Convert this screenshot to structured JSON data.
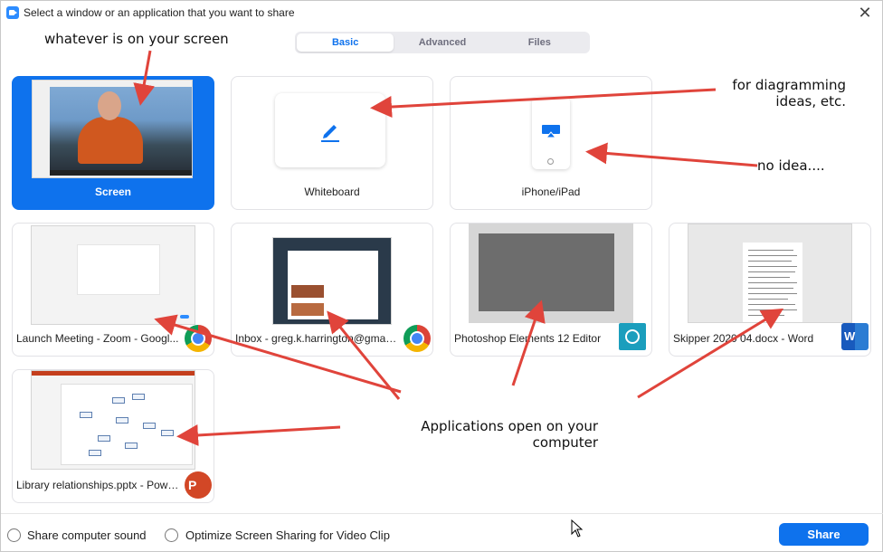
{
  "window": {
    "title": "Select a window or an application that you want to share",
    "close_symbol": "✕"
  },
  "tabs": [
    {
      "label": "Basic",
      "active": true
    },
    {
      "label": "Advanced",
      "active": false
    },
    {
      "label": "Files",
      "active": false
    }
  ],
  "basic_tiles": {
    "screen": {
      "label": "Screen",
      "selected": true
    },
    "whiteboard": {
      "label": "Whiteboard",
      "icon": "pencil-icon"
    },
    "iphone": {
      "label": "iPhone/iPad",
      "icon": "airplay-icon"
    }
  },
  "app_tiles": [
    {
      "label": "Launch Meeting - Zoom - Googl...",
      "app_icon": "chrome-icon"
    },
    {
      "label": "Inbox - greg.k.harrington@gmail....",
      "app_icon": "chrome-icon"
    },
    {
      "label": "Photoshop Elements 12 Editor",
      "app_icon": "photoshop-elements-icon"
    },
    {
      "label": "Skipper 2020 04.docx - Word",
      "app_icon": "word-icon",
      "badge_text": "W"
    },
    {
      "label": "Library relationships.pptx - Powe...",
      "app_icon": "powerpoint-icon",
      "badge_text": "P"
    }
  ],
  "annotations": {
    "screen_note": "whatever is on your screen",
    "whiteboard_note_line1": "for diagramming",
    "whiteboard_note_line2": "ideas, etc.",
    "iphone_note": "no idea....",
    "apps_note_line1": "Applications open on your",
    "apps_note_line2": "computer"
  },
  "footer": {
    "share_sound_label": "Share computer sound",
    "share_sound_checked": false,
    "optimize_label": "Optimize Screen Sharing for Video Clip",
    "optimize_checked": false,
    "share_button_label": "Share"
  },
  "colors": {
    "accent": "#0e72ed",
    "annotation_arrow": "#e0443b"
  }
}
